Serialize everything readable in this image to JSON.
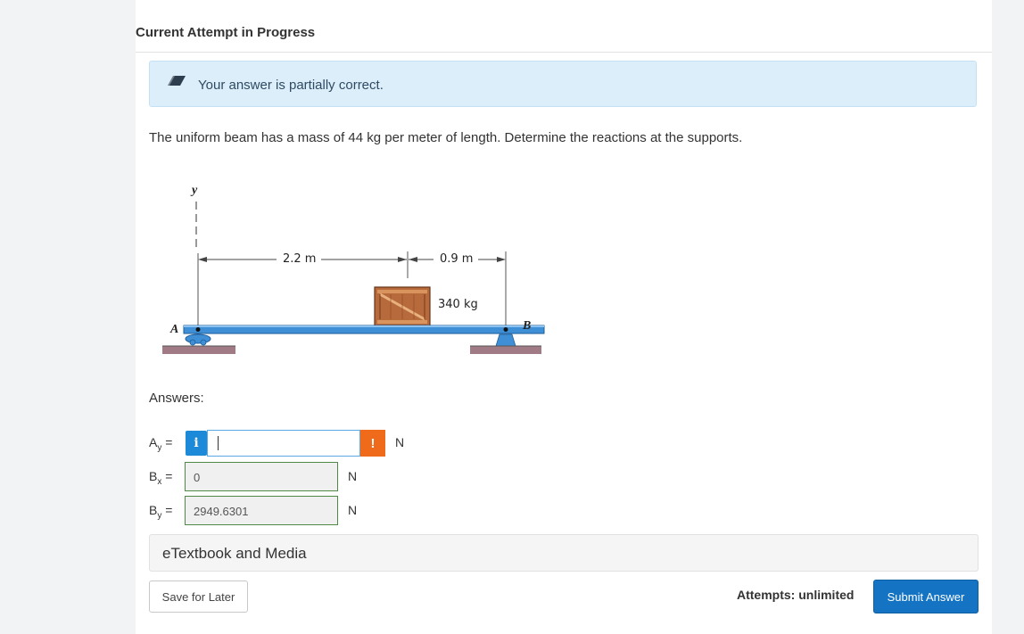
{
  "header": {
    "title": "Current Attempt in Progress"
  },
  "feedback": {
    "icon": "eraser-icon",
    "text": "Your answer is partially correct."
  },
  "question": {
    "text": "The uniform beam has a mass of 44 kg per meter of length. Determine the reactions at the supports."
  },
  "figure": {
    "axis_label": "y",
    "dim_left": "2.2 m",
    "dim_right": "0.9 m",
    "mass_label": "340 kg",
    "support_a": "A",
    "support_b": "B"
  },
  "answers": {
    "label": "Answers:",
    "rows": [
      {
        "var": "A",
        "sub": "y",
        "eq": "=",
        "value": "",
        "unit": "N",
        "status": "incorrect"
      },
      {
        "var": "B",
        "sub": "x",
        "eq": "=",
        "value": "0",
        "unit": "N",
        "status": "correct"
      },
      {
        "var": "B",
        "sub": "y",
        "eq": "=",
        "value": "2949.6301",
        "unit": "N",
        "status": "correct"
      }
    ],
    "info_glyph": "i",
    "warning_glyph": "!"
  },
  "etextbook": {
    "label": "eTextbook and Media"
  },
  "footer": {
    "save_label": "Save for Later",
    "attempts_text": "Attempts: unlimited",
    "submit_label": "Submit Answer"
  },
  "colors": {
    "accent": "#1473c3",
    "info": "#1c8ad9",
    "warning": "#f06a1c",
    "correct_border": "#4e8a43",
    "alert_bg": "#dceefa",
    "beam": "#3e8fd6"
  }
}
